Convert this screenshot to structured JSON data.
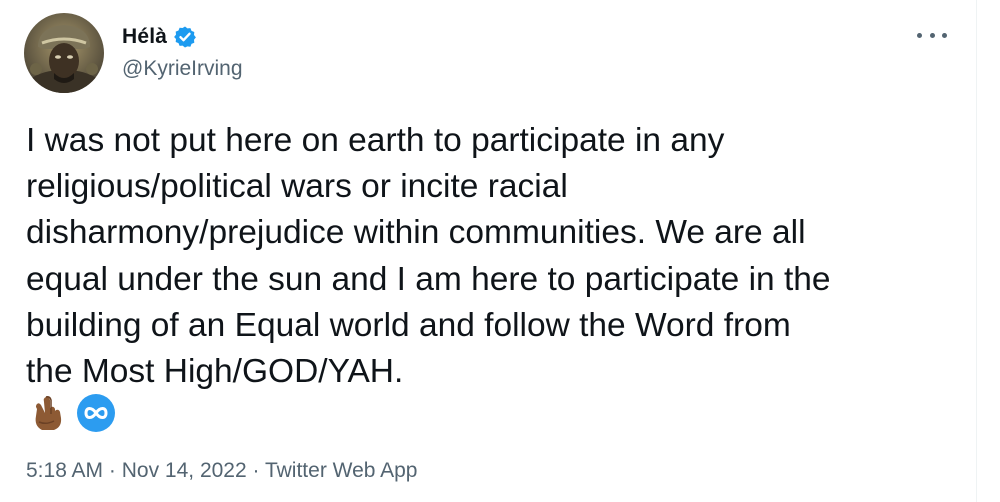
{
  "author": {
    "display_name": "Hélà",
    "handle": "@KyrieIrving",
    "verified": true,
    "avatar_icon": "profile-photo"
  },
  "tweet": {
    "text": "I was not put here on earth to participate in any\nreligious/political wars or incite racial\ndisharmony/prejudice within communities. We are all\nequal under the sun and I am here to participate in the\nbuilding of an Equal world and follow the Word from\nthe Most High/GOD/YAH.",
    "emojis": [
      "crossed-fingers-icon",
      "infinity-icon"
    ]
  },
  "meta": {
    "time": "5:18 AM",
    "separator_1": " · ",
    "date": "Nov 14, 2022",
    "separator_2": " · ",
    "source": "Twitter Web App"
  },
  "colors": {
    "text_primary": "#0f1419",
    "text_secondary": "#536471",
    "verified_blue": "#1d9bf0"
  }
}
